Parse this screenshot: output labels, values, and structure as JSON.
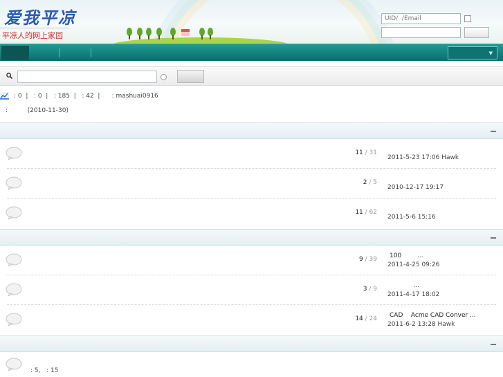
{
  "header": {
    "logo_text": "爱我平凉",
    "logo_subtitle": "平凉人的网上家园"
  },
  "login": {
    "uid_placeholder": "UID/  /Email"
  },
  "stats": {
    "line1": ": 0  |   : 0  |   : 185  |   : 42  |      : mashuai0916",
    "line2": ":          (2010-11-30)"
  },
  "categories": [
    {
      "forums": [
        {
          "topics": "11",
          "posts": "31",
          "last_title": "",
          "last_time": "2011-5-23 17:06 Hawk"
        },
        {
          "topics": "2",
          "posts": "5",
          "last_title": "",
          "last_time": "2010-12-17 19:17"
        },
        {
          "topics": "11",
          "posts": "62",
          "last_title": "",
          "last_time": "2011-5-6 15:16"
        }
      ]
    },
    {
      "forums": [
        {
          "topics": "9",
          "posts": "39",
          "last_title": "100        ...",
          "last_time": "2011-4-25 09:26"
        },
        {
          "topics": "3",
          "posts": "9",
          "last_title": "            ...",
          "last_time": "2011-4-17 18:02"
        },
        {
          "topics": "14",
          "posts": "24",
          "last_title": "CAD    Acme CAD Conver ...",
          "last_time": "2011-6-2 13:28 Hawk"
        }
      ]
    },
    {
      "bottom_text": ": 5,   : 15"
    }
  ],
  "colors": {
    "nav": "#0b6d6a",
    "logo": "#2a5bb6",
    "subtitle": "#d12b2b"
  }
}
